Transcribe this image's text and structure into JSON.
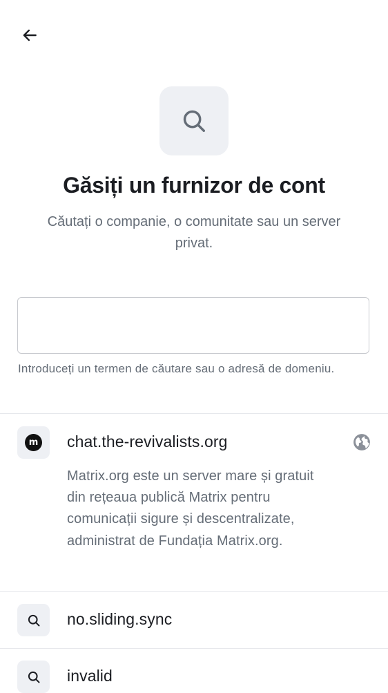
{
  "header": {
    "back_icon": "arrow-left-icon"
  },
  "hero": {
    "icon": "search-icon",
    "title": "Găsiți un furnizor de cont",
    "subtitle": "Căutați o companie, o comunitate sau un server privat."
  },
  "search": {
    "value": "",
    "placeholder": "",
    "helper": "Introduceți un termen de căutare sau o adresă de domeniu."
  },
  "results": [
    {
      "icon": "matrix-logo-icon",
      "logo_letter": "m",
      "name": "chat.the-revivalists.org",
      "trailing_icon": "globe-icon",
      "description": "Matrix.org este un server mare și gratuit din rețeaua publică Matrix pentru comunicații sigure și descentralizate, administrat de Fundația Matrix.org."
    },
    {
      "icon": "search-icon",
      "name": "no.sliding.sync"
    },
    {
      "icon": "search-icon",
      "name": "invalid"
    }
  ],
  "colors": {
    "text_primary": "#1b1d22",
    "text_secondary": "#656d77",
    "icon_background": "#eef0f4",
    "divider": "#e6e8ec",
    "input_border": "#c7c9ce"
  }
}
